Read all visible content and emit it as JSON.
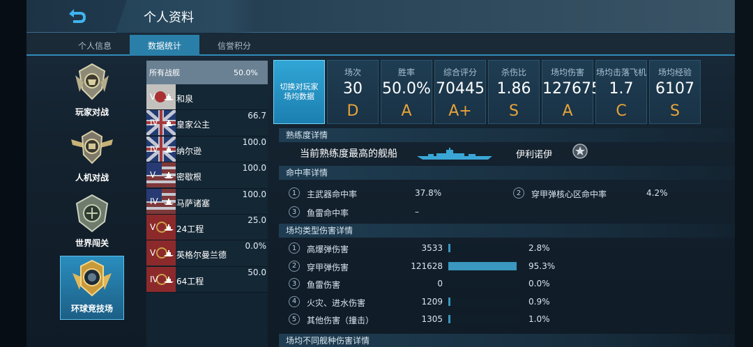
{
  "header": {
    "title": "个人资料"
  },
  "tabs": [
    {
      "label": "个人信息",
      "active": false
    },
    {
      "label": "数据统计",
      "active": true
    },
    {
      "label": "信誉积分",
      "active": false
    }
  ],
  "modes": [
    {
      "label": "玩家对战",
      "active": false
    },
    {
      "label": "人机对战",
      "active": false
    },
    {
      "label": "世界闯关",
      "active": false
    },
    {
      "label": "环球竞技场",
      "active": true
    }
  ],
  "ship_list": {
    "all": {
      "label": "所有战舰",
      "value": "50.0%"
    },
    "ships": [
      {
        "tier": "V",
        "name": "和泉",
        "pct": "",
        "flag": "japan"
      },
      {
        "tier": "IV",
        "name": "皇家公主",
        "pct": "66.7",
        "flag": "uk"
      },
      {
        "tier": "IV",
        "name": "纳尔逊",
        "pct": "100.0",
        "flag": "uk"
      },
      {
        "tier": "V",
        "name": "密歇根",
        "pct": "100.0",
        "flag": "us"
      },
      {
        "tier": "IV",
        "name": "马萨诸塞",
        "pct": "100.0",
        "flag": "us"
      },
      {
        "tier": "V",
        "name": "24工程",
        "pct": "25.0",
        "flag": "soviet"
      },
      {
        "tier": "V",
        "name": "英格尔曼兰德",
        "pct": "0.0%",
        "flag": "soviet"
      },
      {
        "tier": "IV",
        "name": "64工程",
        "pct": "50.0",
        "flag": "soviet"
      }
    ]
  },
  "stats": {
    "switch_label": "切换对玩家场均数据",
    "cells": [
      {
        "label": "场次",
        "value": "30",
        "grade": "D"
      },
      {
        "label": "胜率",
        "value": "50.0%",
        "grade": "A"
      },
      {
        "label": "综合评分",
        "value": "70445",
        "grade": "A+"
      },
      {
        "label": "杀伤比",
        "value": "1.86",
        "grade": "S"
      },
      {
        "label": "场均伤害",
        "value": "127675",
        "grade": "A"
      },
      {
        "label": "场均击落飞机",
        "value": "1.7",
        "grade": "C"
      },
      {
        "label": "场均经验",
        "value": "6107",
        "grade": "S"
      }
    ]
  },
  "proficiency": {
    "header": "熟练度详情",
    "label": "当前熟练度最高的舰船",
    "ship_name": "伊利诺伊",
    "badge_icon": "star-badge-icon"
  },
  "hit_rate": {
    "header": "命中率详情",
    "rows": [
      {
        "num": "1",
        "label": "主武器命中率",
        "value": "37.8%"
      },
      {
        "num": "2",
        "label": "穿甲弹核心区命中率",
        "value": "4.2%"
      },
      {
        "num": "3",
        "label": "鱼雷命中率",
        "value": "–"
      }
    ]
  },
  "damage_types": {
    "header": "场均类型伤害详情",
    "rows": [
      {
        "num": "1",
        "label": "高爆弹伤害",
        "value": "3533",
        "pct": "2.8%",
        "fraction": 0.028
      },
      {
        "num": "2",
        "label": "穿甲弹伤害",
        "value": "121628",
        "pct": "95.3%",
        "fraction": 0.953
      },
      {
        "num": "3",
        "label": "鱼雷伤害",
        "value": "0",
        "pct": "0.0%",
        "fraction": 0.0
      },
      {
        "num": "4",
        "label": "火灾、进水伤害",
        "value": "1209",
        "pct": "0.9%",
        "fraction": 0.009
      },
      {
        "num": "5",
        "label": "其他伤害（撞击）",
        "value": "1305",
        "pct": "1.0%",
        "fraction": 0.01
      }
    ]
  },
  "ship_type_damage": {
    "header": "场均不同舰种伤害详情"
  },
  "colors": {
    "accent": "#2a7fa8",
    "grade": "#e8a33a",
    "bar": "#3a97bf"
  }
}
